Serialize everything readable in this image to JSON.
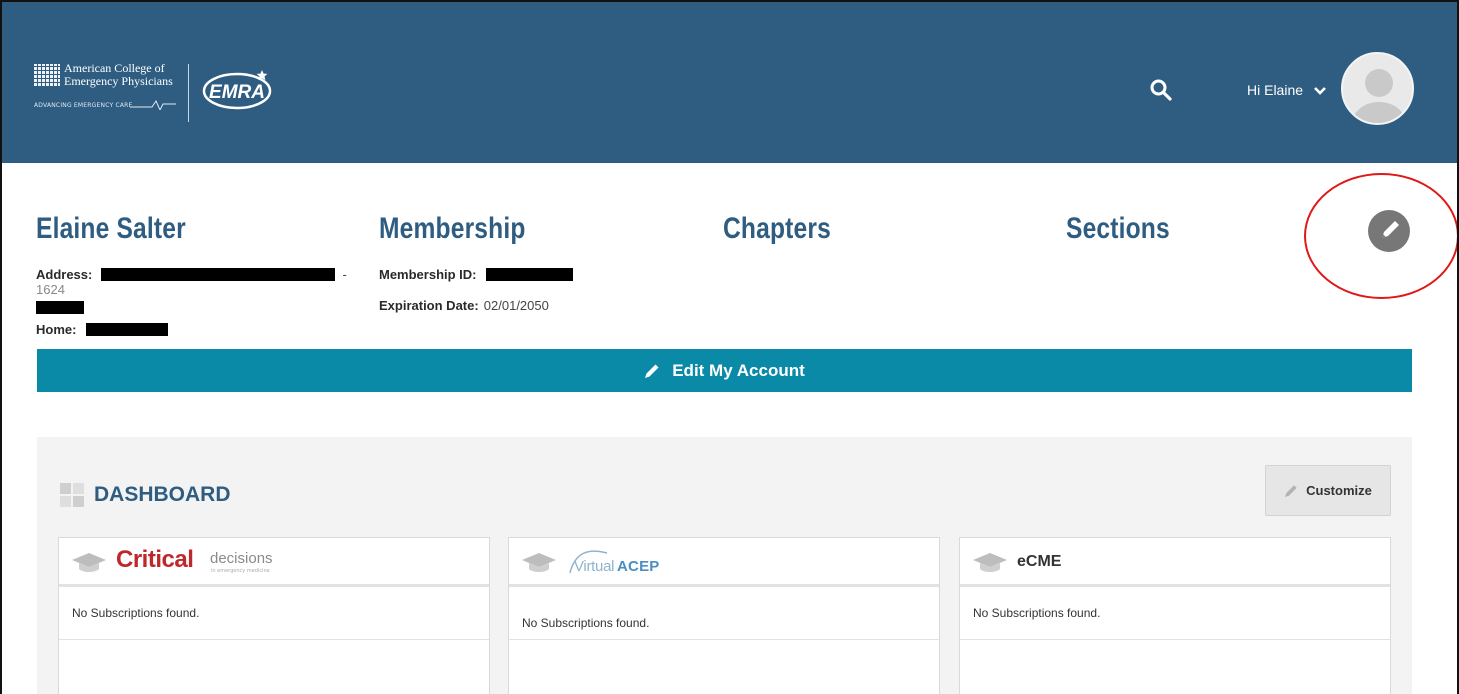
{
  "header": {
    "acep_logo_line1": "American College of",
    "acep_logo_line2": "Emergency Physicians",
    "acep_logo_tagline": "ADVANCING EMERGENCY CARE",
    "emra_logo": "EMRA",
    "greeting": "Hi Elaine",
    "colors": {
      "bar": "#2f5d82"
    }
  },
  "profile": {
    "name": "Elaine Salter",
    "address_label": "Address:",
    "address_fragment": "1624",
    "home_label": "Home:",
    "membership_heading": "Membership",
    "membership_id_label": "Membership ID:",
    "expiration_label": "Expiration Date:",
    "expiration_value": "02/01/2050",
    "chapters_heading": "Chapters",
    "sections_heading": "Sections"
  },
  "edit_bar": {
    "label": "Edit My Account",
    "color": "#0a8aa7"
  },
  "dashboard": {
    "title": "DASHBOARD",
    "customize_label": "Customize",
    "cards": [
      {
        "logo_main": "Critical",
        "logo_sub": "decisions",
        "logo_sub2": "in emergency medicine",
        "empty_text": "No Subscriptions found."
      },
      {
        "logo_main": "Virtual",
        "logo_sub": "ACEP",
        "empty_text": "No Subscriptions found."
      },
      {
        "logo_main": "eCME",
        "empty_text": "No Subscriptions found."
      }
    ]
  },
  "icons": [
    "search-icon",
    "chevron-down-icon",
    "avatar-icon",
    "pencil-icon",
    "grid-icon",
    "graduation-cap-icon"
  ]
}
